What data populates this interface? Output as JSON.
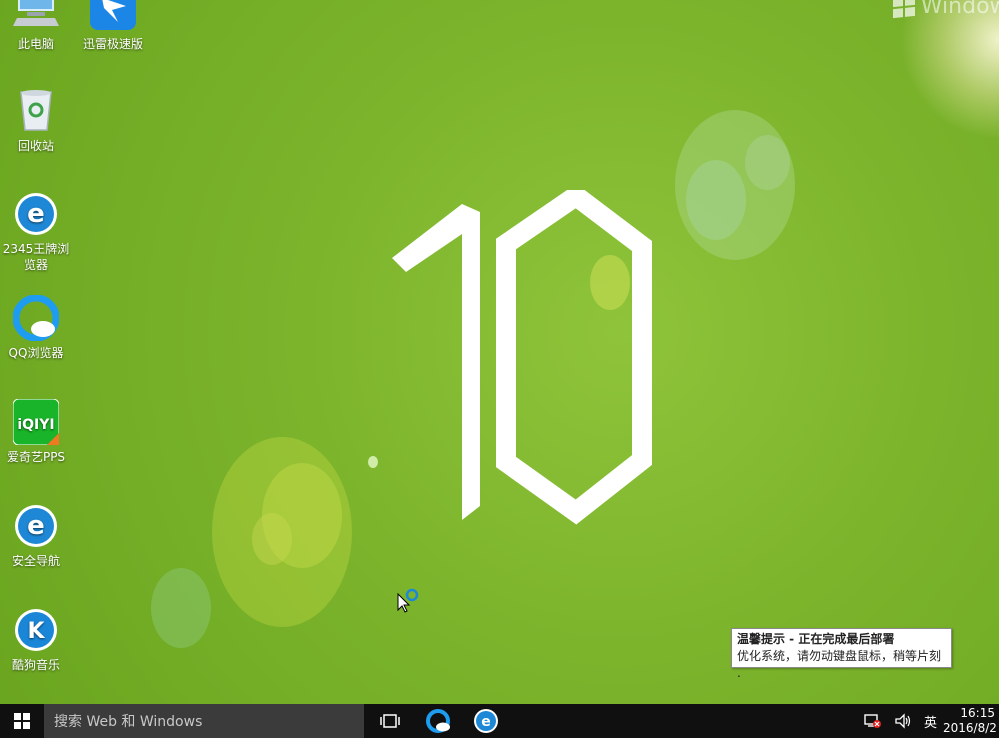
{
  "desktop": {
    "icons": [
      {
        "label": "此电脑"
      },
      {
        "label": "迅雷极速版"
      },
      {
        "label": "回收站"
      },
      {
        "label": "2345王牌浏览器"
      },
      {
        "label": "QQ浏览器"
      },
      {
        "label": "爱奇艺PPS"
      },
      {
        "label": "安全导航"
      },
      {
        "label": "酷狗音乐"
      }
    ],
    "watermark": "Windows",
    "iqiyi_text": "iQIYI",
    "kugou_letter": "K",
    "ie_letter": "e"
  },
  "notification": {
    "title": "温馨提示 - 正在完成最后部署",
    "body": "优化系统，请勿动键盘鼠标，稍等片刻 ."
  },
  "taskbar": {
    "search_placeholder": "搜索 Web 和 Windows",
    "ime": "英",
    "time": "16:15",
    "date": "2016/8/2"
  },
  "colors": {
    "wallpaper": "#7db52d",
    "taskbar": "#101010",
    "search": "#3b3b3b",
    "accent_blue": "#1e88d6"
  }
}
